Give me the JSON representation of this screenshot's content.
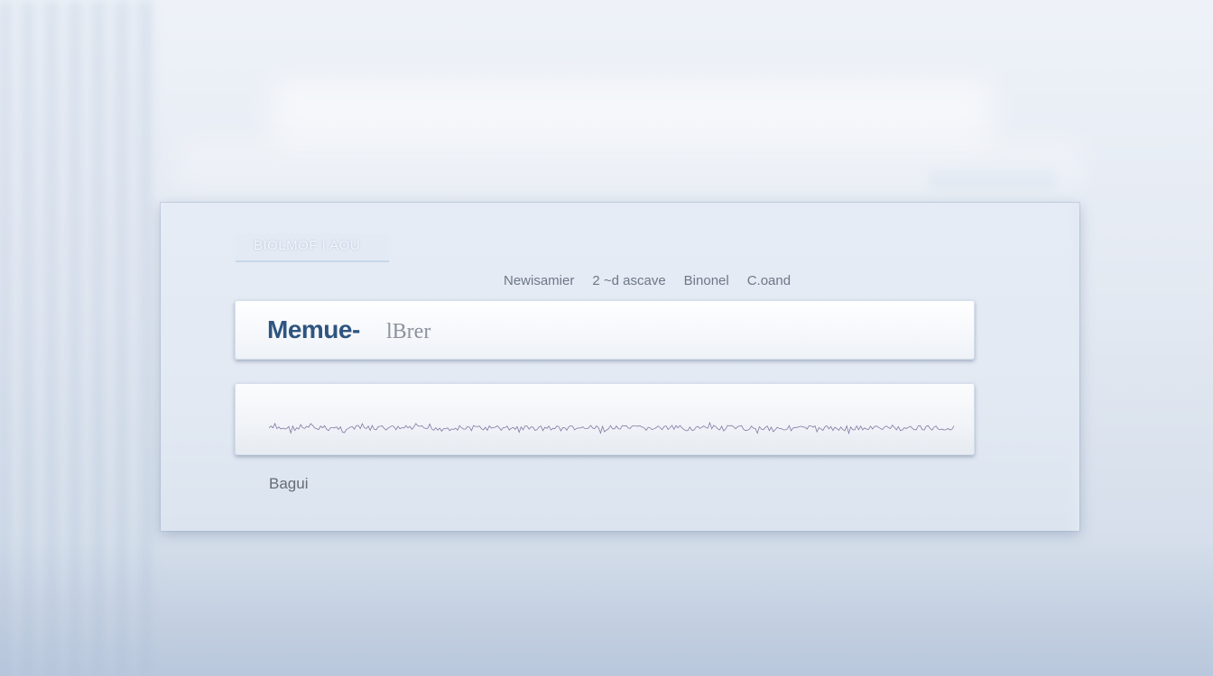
{
  "brand": {
    "title": "BIOLMOF I AOU"
  },
  "nav": {
    "items": [
      {
        "label": "Newisamier"
      },
      {
        "label": "2 ~d ascave"
      },
      {
        "label": "Binonel"
      },
      {
        "label": "C.oand"
      }
    ]
  },
  "search": {
    "value": "Memue-",
    "hint": "lBrer"
  },
  "footer": {
    "label": "Bagui"
  },
  "colors": {
    "accent": "#2e557f",
    "panel": "#e4eaf3",
    "waveform": "#6e6494"
  },
  "icons": []
}
